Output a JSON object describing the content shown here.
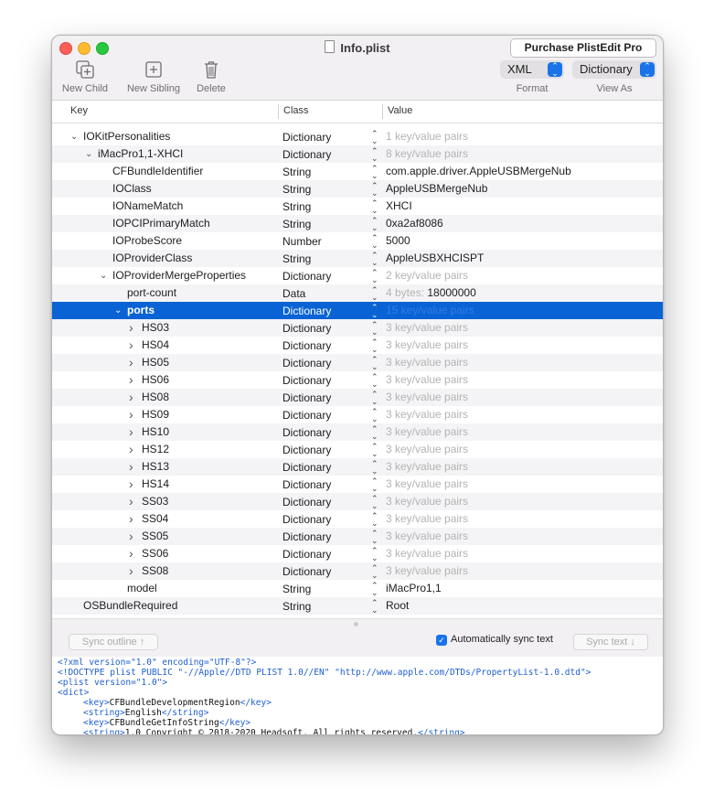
{
  "window": {
    "title": "Info.plist",
    "purchase_label": "Purchase PlistEdit Pro"
  },
  "toolbar": {
    "new_child": "New Child",
    "new_sibling": "New Sibling",
    "delete": "Delete",
    "format_value": "XML",
    "format_label": "Format",
    "viewas_value": "Dictionary",
    "viewas_label": "View As"
  },
  "columns": {
    "key": "Key",
    "class": "Class",
    "value": "Value"
  },
  "rows": [
    {
      "key": "IOKitPersonalities",
      "class": "Dictionary",
      "value": "1 key/value pairs",
      "dim": true,
      "level": 0,
      "disclosure": "open"
    },
    {
      "key": "iMacPro1,1-XHCI",
      "class": "Dictionary",
      "value": "8 key/value pairs",
      "dim": true,
      "level": 1,
      "disclosure": "open"
    },
    {
      "key": "CFBundleIdentifier",
      "class": "String",
      "value": "com.apple.driver.AppleUSBMergeNub",
      "dim": false,
      "level": 2,
      "disclosure": ""
    },
    {
      "key": "IOClass",
      "class": "String",
      "value": "AppleUSBMergeNub",
      "dim": false,
      "level": 2,
      "disclosure": ""
    },
    {
      "key": "IONameMatch",
      "class": "String",
      "value": "XHCI",
      "dim": false,
      "level": 2,
      "disclosure": ""
    },
    {
      "key": "IOPCIPrimaryMatch",
      "class": "String",
      "value": "0xa2af8086",
      "dim": false,
      "level": 2,
      "disclosure": ""
    },
    {
      "key": "IOProbeScore",
      "class": "Number",
      "value": "5000",
      "dim": false,
      "level": 2,
      "disclosure": ""
    },
    {
      "key": "IOProviderClass",
      "class": "String",
      "value": "AppleUSBXHCISPT",
      "dim": false,
      "level": 2,
      "disclosure": ""
    },
    {
      "key": "IOProviderMergeProperties",
      "class": "Dictionary",
      "value": "2 key/value pairs",
      "dim": true,
      "level": 2,
      "disclosure": "open"
    },
    {
      "key": "port-count",
      "class": "Data",
      "value": "4 bytes: ",
      "value_extra": "18000000",
      "dim": true,
      "level": 3,
      "disclosure": ""
    },
    {
      "key": "ports",
      "class": "Dictionary",
      "value": "15 key/value pairs",
      "dim": true,
      "level": 3,
      "disclosure": "open",
      "selected": true
    },
    {
      "key": "HS03",
      "class": "Dictionary",
      "value": "3 key/value pairs",
      "dim": true,
      "level": 4,
      "disclosure": "closed"
    },
    {
      "key": "HS04",
      "class": "Dictionary",
      "value": "3 key/value pairs",
      "dim": true,
      "level": 4,
      "disclosure": "closed"
    },
    {
      "key": "HS05",
      "class": "Dictionary",
      "value": "3 key/value pairs",
      "dim": true,
      "level": 4,
      "disclosure": "closed"
    },
    {
      "key": "HS06",
      "class": "Dictionary",
      "value": "3 key/value pairs",
      "dim": true,
      "level": 4,
      "disclosure": "closed"
    },
    {
      "key": "HS08",
      "class": "Dictionary",
      "value": "3 key/value pairs",
      "dim": true,
      "level": 4,
      "disclosure": "closed"
    },
    {
      "key": "HS09",
      "class": "Dictionary",
      "value": "3 key/value pairs",
      "dim": true,
      "level": 4,
      "disclosure": "closed"
    },
    {
      "key": "HS10",
      "class": "Dictionary",
      "value": "3 key/value pairs",
      "dim": true,
      "level": 4,
      "disclosure": "closed"
    },
    {
      "key": "HS12",
      "class": "Dictionary",
      "value": "3 key/value pairs",
      "dim": true,
      "level": 4,
      "disclosure": "closed"
    },
    {
      "key": "HS13",
      "class": "Dictionary",
      "value": "3 key/value pairs",
      "dim": true,
      "level": 4,
      "disclosure": "closed"
    },
    {
      "key": "HS14",
      "class": "Dictionary",
      "value": "3 key/value pairs",
      "dim": true,
      "level": 4,
      "disclosure": "closed"
    },
    {
      "key": "SS03",
      "class": "Dictionary",
      "value": "3 key/value pairs",
      "dim": true,
      "level": 4,
      "disclosure": "closed"
    },
    {
      "key": "SS04",
      "class": "Dictionary",
      "value": "3 key/value pairs",
      "dim": true,
      "level": 4,
      "disclosure": "closed"
    },
    {
      "key": "SS05",
      "class": "Dictionary",
      "value": "3 key/value pairs",
      "dim": true,
      "level": 4,
      "disclosure": "closed"
    },
    {
      "key": "SS06",
      "class": "Dictionary",
      "value": "3 key/value pairs",
      "dim": true,
      "level": 4,
      "disclosure": "closed"
    },
    {
      "key": "SS08",
      "class": "Dictionary",
      "value": "3 key/value pairs",
      "dim": true,
      "level": 4,
      "disclosure": "closed"
    },
    {
      "key": "model",
      "class": "String",
      "value": "iMacPro1,1",
      "dim": false,
      "level": 3,
      "disclosure": ""
    },
    {
      "key": "OSBundleRequired",
      "class": "String",
      "value": "Root",
      "dim": false,
      "level": 0,
      "disclosure": ""
    }
  ],
  "sync": {
    "sync_outline": "Sync outline ↑",
    "auto_sync": "Automatically sync text",
    "sync_text": "Sync text ↓"
  },
  "xml_lines": [
    {
      "indent": 0,
      "parts": [
        {
          "t": "<?xml version=\"1.0\" encoding=\"UTF-8\"?>",
          "c": "tag"
        }
      ]
    },
    {
      "indent": 0,
      "parts": [
        {
          "t": "<!DOCTYPE plist PUBLIC \"-//Apple//DTD PLIST 1.0//EN\" \"http://www.apple.com/DTDs/PropertyList-1.0.dtd\">",
          "c": "tag"
        }
      ]
    },
    {
      "indent": 0,
      "parts": [
        {
          "t": "<plist version=\"1.0\">",
          "c": "tag"
        }
      ]
    },
    {
      "indent": 0,
      "parts": [
        {
          "t": "<dict>",
          "c": "tag"
        }
      ]
    },
    {
      "indent": 1,
      "parts": [
        {
          "t": "<key>",
          "c": "tag"
        },
        {
          "t": "CFBundleDevelopmentRegion",
          "c": "text"
        },
        {
          "t": "</key>",
          "c": "tag"
        }
      ]
    },
    {
      "indent": 1,
      "parts": [
        {
          "t": "<string>",
          "c": "tag"
        },
        {
          "t": "English",
          "c": "text"
        },
        {
          "t": "</string>",
          "c": "tag"
        }
      ]
    },
    {
      "indent": 1,
      "parts": [
        {
          "t": "<key>",
          "c": "tag"
        },
        {
          "t": "CFBundleGetInfoString",
          "c": "text"
        },
        {
          "t": "</key>",
          "c": "tag"
        }
      ]
    },
    {
      "indent": 1,
      "parts": [
        {
          "t": "<string>",
          "c": "tag"
        },
        {
          "t": "1.0 Copyright © 2018-2020 Headsoft. All rights reserved.",
          "c": "text"
        },
        {
          "t": "</string>",
          "c": "tag"
        }
      ]
    }
  ],
  "colors": {
    "selection": "#0a63d4",
    "accent": "#1a73e8",
    "xml_tag": "#1f5fd1"
  }
}
